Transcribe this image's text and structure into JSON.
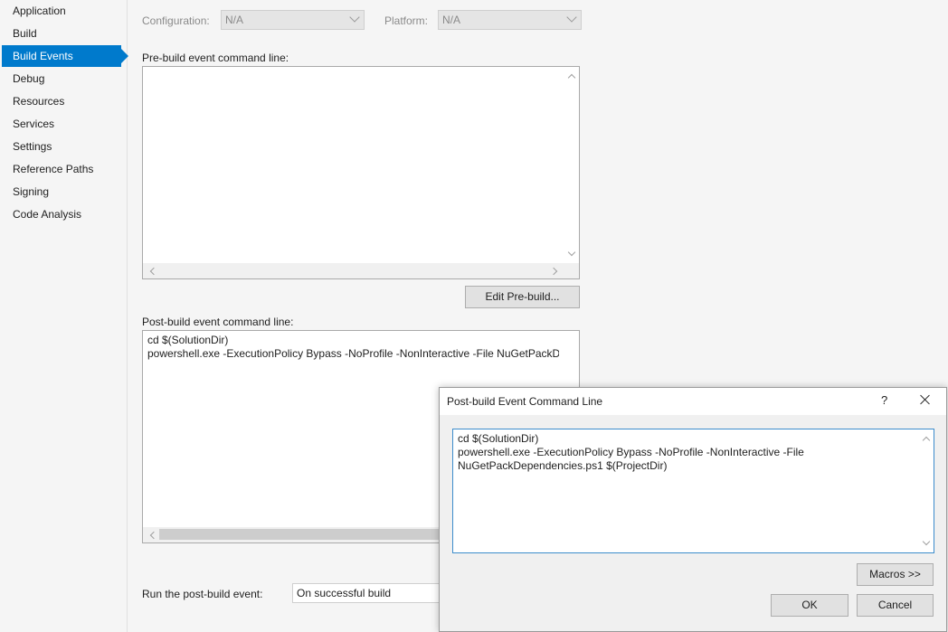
{
  "sidebar": {
    "items": [
      {
        "label": "Application",
        "active": false
      },
      {
        "label": "Build",
        "active": false
      },
      {
        "label": "Build Events",
        "active": true
      },
      {
        "label": "Debug",
        "active": false
      },
      {
        "label": "Resources",
        "active": false
      },
      {
        "label": "Services",
        "active": false
      },
      {
        "label": "Settings",
        "active": false
      },
      {
        "label": "Reference Paths",
        "active": false
      },
      {
        "label": "Signing",
        "active": false
      },
      {
        "label": "Code Analysis",
        "active": false
      }
    ]
  },
  "config": {
    "configuration_label": "Configuration:",
    "configuration_value": "N/A",
    "platform_label": "Platform:",
    "platform_value": "N/A"
  },
  "prebuild": {
    "label": "Pre-build event command line:",
    "lines": [],
    "edit_button": "Edit Pre-build..."
  },
  "postbuild": {
    "label": "Post-build event command line:",
    "lines": [
      "cd $(SolutionDir)",
      "powershell.exe -ExecutionPolicy Bypass -NoProfile -NonInteractive -File NuGetPackDep"
    ]
  },
  "run_post_build": {
    "label": "Run the post-build event:",
    "value": "On successful build"
  },
  "dialog": {
    "title": "Post-build Event Command Line",
    "help_glyph": "?",
    "lines": [
      "cd $(SolutionDir)",
      "powershell.exe -ExecutionPolicy Bypass -NoProfile -NonInteractive -File",
      "NuGetPackDependencies.ps1 $(ProjectDir)"
    ],
    "macros_button": "Macros >>",
    "ok_button": "OK",
    "cancel_button": "Cancel"
  },
  "colors": {
    "accent": "#007acc",
    "background": "#f5f5f5",
    "dialog_border_focus": "#3c8ccc"
  }
}
